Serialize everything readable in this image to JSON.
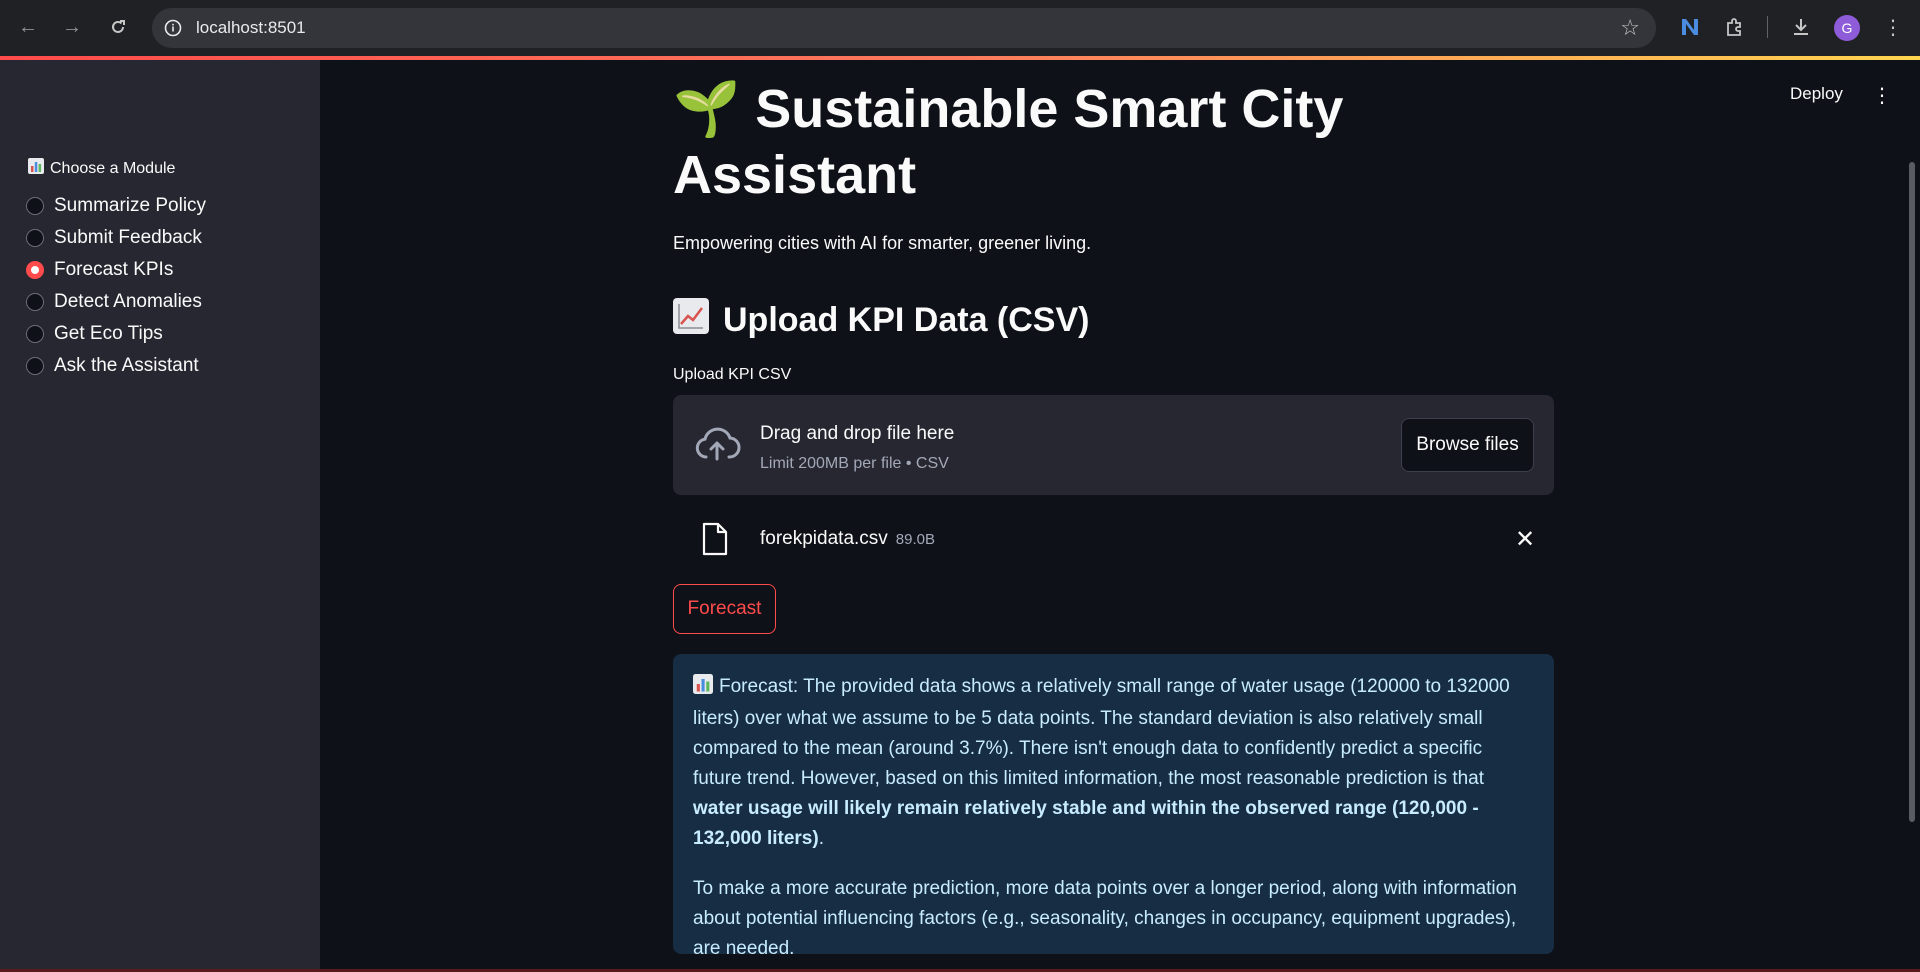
{
  "browser": {
    "url": "localhost:8501",
    "avatar_letter": "G"
  },
  "sidebar": {
    "radio_label": "Choose a Module",
    "options": [
      {
        "label": "Summarize Policy",
        "selected": false
      },
      {
        "label": "Submit Feedback",
        "selected": false
      },
      {
        "label": "Forecast KPIs",
        "selected": true
      },
      {
        "label": "Detect Anomalies",
        "selected": false
      },
      {
        "label": "Get Eco Tips",
        "selected": false
      },
      {
        "label": "Ask the Assistant",
        "selected": false
      }
    ]
  },
  "header": {
    "deploy_label": "Deploy"
  },
  "main": {
    "title_emoji": "🌱",
    "title": "Sustainable Smart City Assistant",
    "subtitle": "Empowering cities with AI for smarter, greener living.",
    "section_title": "Upload KPI Data (CSV)",
    "uploader": {
      "label": "Upload KPI CSV",
      "drop_text": "Drag and drop file here",
      "hint": "Limit 200MB per file • CSV",
      "browse_label": "Browse files"
    },
    "uploaded_file": {
      "name": "forekpidata.csv",
      "size": "89.0B"
    },
    "forecast_button": "Forecast",
    "result": {
      "p1_prefix": "Forecast: The provided data shows a relatively small range of water usage (120000 to 132000 liters) over what we assume to be 5 data points. The standard deviation is also relatively small compared to the mean (around 3.7%). There isn't enough data to confidently predict a specific future trend. However, based on this limited information, the most reasonable prediction is that ",
      "p1_bold": "water usage will likely remain relatively stable and within the observed range (120,000 - 132,000 liters)",
      "p1_suffix": ".",
      "p2": "To make a more accurate prediction, more data points over a longer period, along with information about potential influencing factors (e.g., seasonality, changes in occupancy, equipment upgrades), are needed."
    }
  },
  "colors": {
    "accent": "#ff4b4b",
    "sidebar_bg": "#262730",
    "page_bg": "#0e1117",
    "info_bg": "#172d43",
    "info_text": "#c7ebff"
  }
}
